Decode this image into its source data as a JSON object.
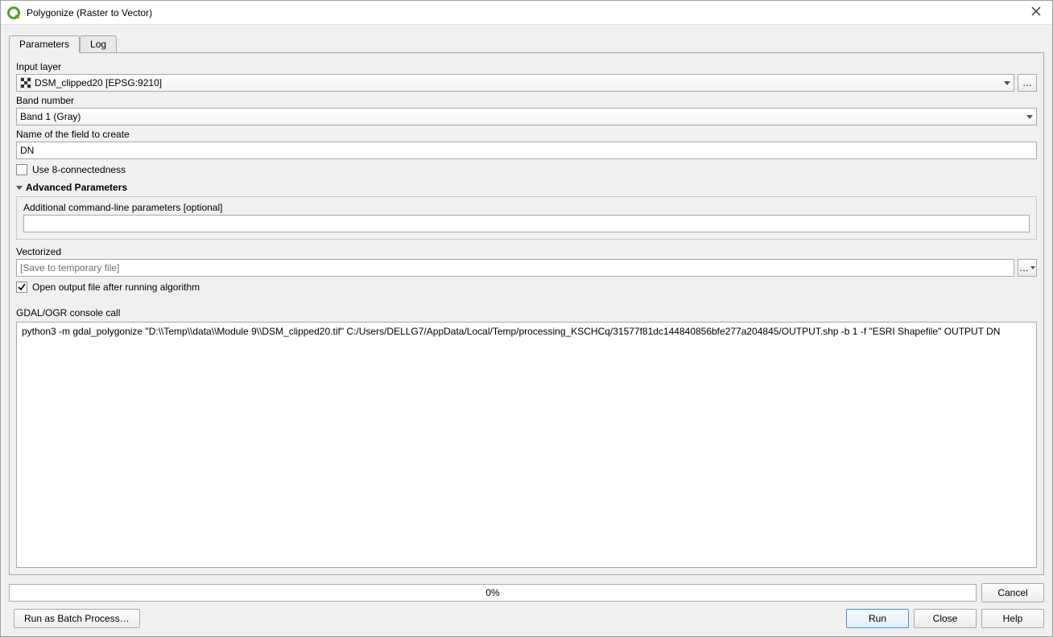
{
  "window": {
    "title": "Polygonize (Raster to Vector)"
  },
  "tabs": {
    "parameters": "Parameters",
    "log": "Log"
  },
  "labels": {
    "input_layer": "Input layer",
    "band_number": "Band number",
    "field_name": "Name of the field to create",
    "use8": "Use 8-connectedness",
    "advanced": "Advanced Parameters",
    "additional": "Additional command-line parameters [optional]",
    "vectorized": "Vectorized",
    "open_output": "Open output file after running algorithm",
    "console_call": "GDAL/OGR console call"
  },
  "values": {
    "input_layer": "DSM_clipped20 [EPSG:9210]",
    "band_number": "Band 1 (Gray)",
    "field_name": "DN",
    "additional": "",
    "vectorized_placeholder": "[Save to temporary file]",
    "console_text": "python3 -m gdal_polygonize \"D:\\\\Temp\\\\data\\\\Module 9\\\\DSM_clipped20.tif\" C:/Users/DELLG7/AppData/Local/Temp/processing_KSCHCq/31577f81dc144840856bfe277a204845/OUTPUT.shp -b 1 -f \"ESRI Shapefile\" OUTPUT DN",
    "progress": "0%"
  },
  "buttons": {
    "browse": "…",
    "browse_menu": "…",
    "cancel": "Cancel",
    "batch": "Run as Batch Process…",
    "run": "Run",
    "close": "Close",
    "help": "Help"
  }
}
